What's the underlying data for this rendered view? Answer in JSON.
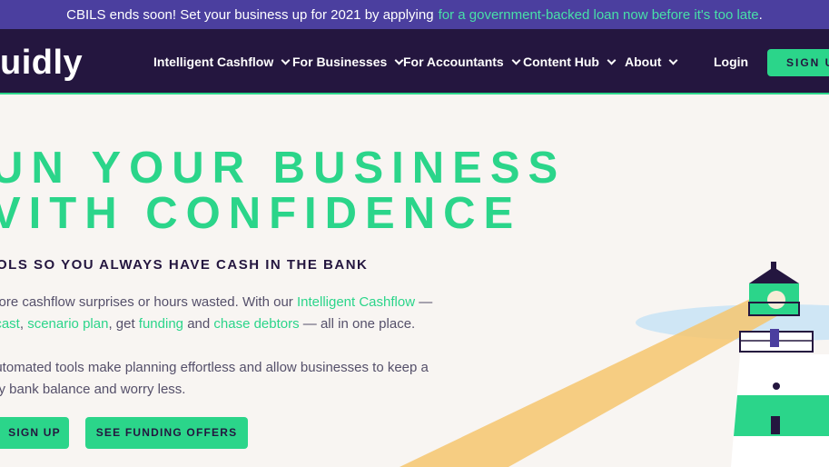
{
  "banner": {
    "text": "CBILS ends soon! Set your business up for 2021 by applying",
    "link": "for a government-backed loan now before it's too late",
    "end": "."
  },
  "nav": {
    "logo": "uidly",
    "items": [
      {
        "label": "Intelligent Cashflow"
      },
      {
        "label": "For Businesses"
      },
      {
        "label": "For Accountants"
      },
      {
        "label": "Content Hub"
      },
      {
        "label": "About"
      }
    ],
    "login": "Login",
    "signup": "SIGN UP"
  },
  "hero": {
    "title_line1": "UN YOUR BUSINESS",
    "title_line2": "VITH CONFIDENCE",
    "subtitle": "OLS SO YOU ALWAYS HAVE CASH IN THE BANK",
    "para1": {
      "t1": "more cashflow surprises or hours wasted. With our",
      "link1": "Intelligent Cashflow",
      "t2": "—",
      "link2": "ecast",
      "t3": ",",
      "link3": "scenario plan",
      "t4": ", get",
      "link4": "funding",
      "t5": "and",
      "link5": "chase debtors",
      "t6": "— all in one place."
    },
    "para2": {
      "line1": "automated tools make planning effortless and allow businesses to keep a",
      "line2": "thy bank balance and worry less."
    },
    "btn_signup": "SIGN UP",
    "btn_funding": "SEE FUNDING OFFERS"
  },
  "colors": {
    "accent": "#2bd58a",
    "nav_bg": "#24163f",
    "banner_bg": "#4b3f9f",
    "page_bg": "#f8f5f2",
    "beam": "#f6c56f"
  }
}
